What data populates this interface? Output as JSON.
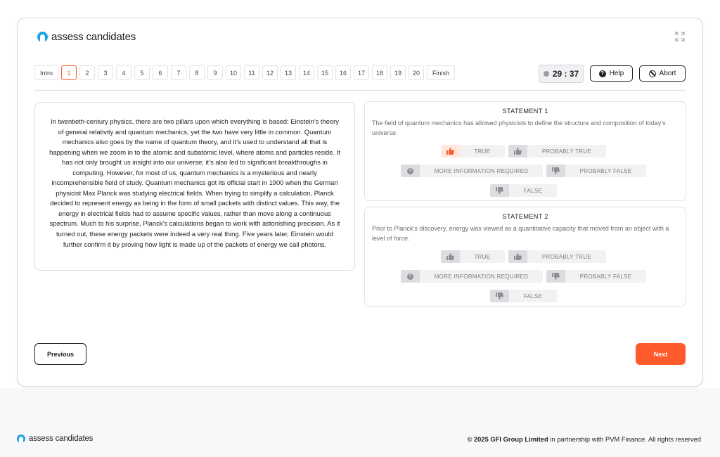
{
  "brand": {
    "name": "assess candidates",
    "accent_color": "#ff5a2c",
    "logo_color": "#1aa3e8"
  },
  "nav": {
    "intro_label": "Intro",
    "questions": [
      "1",
      "2",
      "3",
      "4",
      "5",
      "6",
      "7",
      "8",
      "9",
      "10",
      "11",
      "12",
      "13",
      "14",
      "15",
      "16",
      "17",
      "18",
      "19",
      "20"
    ],
    "active_question": "1",
    "finish_label": "Finish"
  },
  "toolbar": {
    "timer": "29 : 37",
    "help_label": "Help",
    "abort_label": "Abort",
    "expand_icon": "expand-icon"
  },
  "passage": {
    "text": "In twentieth-century physics, there are two pillars upon which everything is based: Einstein’s theory of general relativity and quantum mechanics, yet the two have very little in common. Quantum mechanics also goes by the name of quantum theory, and it’s used to understand all that is happening when we zoom in to the atomic and subatomic level, where atoms and particles reside. It has not only brought us insight into our universe; it’s also led to significant breakthroughs in computing. However, for most of us, quantum mechanics is a mysterious and nearly incomprehensible field of study. Quantum mechanics got its official start in 1900 when the German physicist Max Planck was studying electrical fields. When trying to simplify a calculation, Planck decided to represent energy as being in the form of small packets with distinct values. This way, the energy in electrical fields had to assume specific values, rather than move along a continuous spectrum. Much to his surprise, Planck’s calculations began to work with astonishing precision. As it turned out, these energy packets were indeed a very real thing. Five years later, Einstein would further confirm it by proving how light is made up of the packets of energy we call photons."
  },
  "statements": [
    {
      "title": "STATEMENT 1",
      "text": "The field of quantum mechanics has allowed physicists to define the structure and composition of today’s universe.",
      "selected": "TRUE"
    },
    {
      "title": "STATEMENT 2",
      "text": "Prior to Planck’s discovery, energy was viewed as a quantitative capacity that moved from an object with a level of force.",
      "selected": ""
    }
  ],
  "options": {
    "true": "TRUE",
    "probably_true": "PROBABLY TRUE",
    "more_info": "MORE INFORMATION REQUIRED",
    "probably_false": "PROBABLY FALSE",
    "false": "FALSE"
  },
  "buttons": {
    "previous": "Previous",
    "next": "Next"
  },
  "footer": {
    "copyright_bold": "© 2025 GFI Group Limited",
    "copyright_rest": " in partnership with PVM Finance. All rights reserved"
  }
}
